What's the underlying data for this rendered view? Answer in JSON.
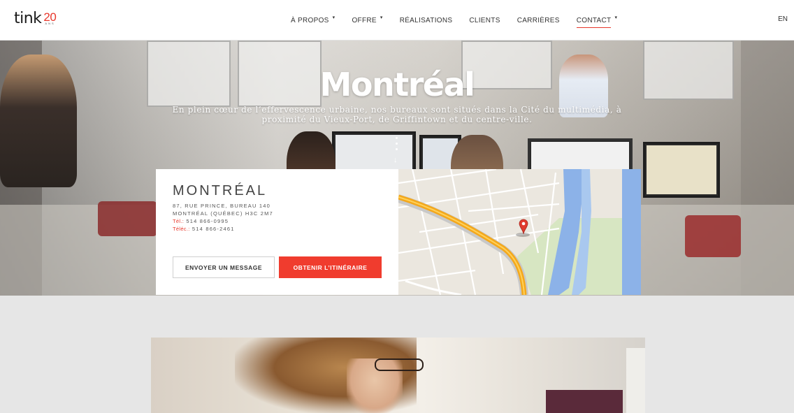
{
  "header": {
    "logo": {
      "word": "tink",
      "number": "20",
      "suffix": "ANS"
    },
    "nav": [
      {
        "label": "À PROPOS",
        "has_dropdown": true,
        "active": false
      },
      {
        "label": "OFFRE",
        "has_dropdown": true,
        "active": false
      },
      {
        "label": "RÉALISATIONS",
        "has_dropdown": false,
        "active": false
      },
      {
        "label": "CLIENTS",
        "has_dropdown": false,
        "active": false
      },
      {
        "label": "CARRIÈRES",
        "has_dropdown": false,
        "active": false
      },
      {
        "label": "CONTACT",
        "has_dropdown": true,
        "active": true
      }
    ],
    "language": "EN"
  },
  "hero": {
    "title": "Montréal",
    "subtitle": "En plein cœur de l’effervescence urbaine, nos bureaux sont situés dans la Cité du multimédia, à proximité du Vieux-Port, de Griffintown et du centre-ville."
  },
  "office": {
    "city": "MONTRÉAL",
    "address_line1": "87, RUE PRINCE, BUREAU 140",
    "address_line2": "MONTRÉAL (QUÉBEC)  H3C 2M7",
    "tel_label": "Tél.",
    "tel": "514 866-0995",
    "fax_label": "Téléc.",
    "fax": "514 866-2461",
    "message_button": "ENVOYER UN MESSAGE",
    "directions_button": "OBTENIR L’ITINÉRAIRE"
  },
  "colors": {
    "accent": "#e8372b",
    "button_red": "#f03c2e",
    "map_road": "#f4a81c",
    "map_water": "#8cb2e8",
    "map_park": "#c8dfa8"
  },
  "icons": {
    "caret": "caret-down-icon",
    "scroll": "scroll-down-arrow-icon",
    "map_pin": "map-pin-icon"
  }
}
